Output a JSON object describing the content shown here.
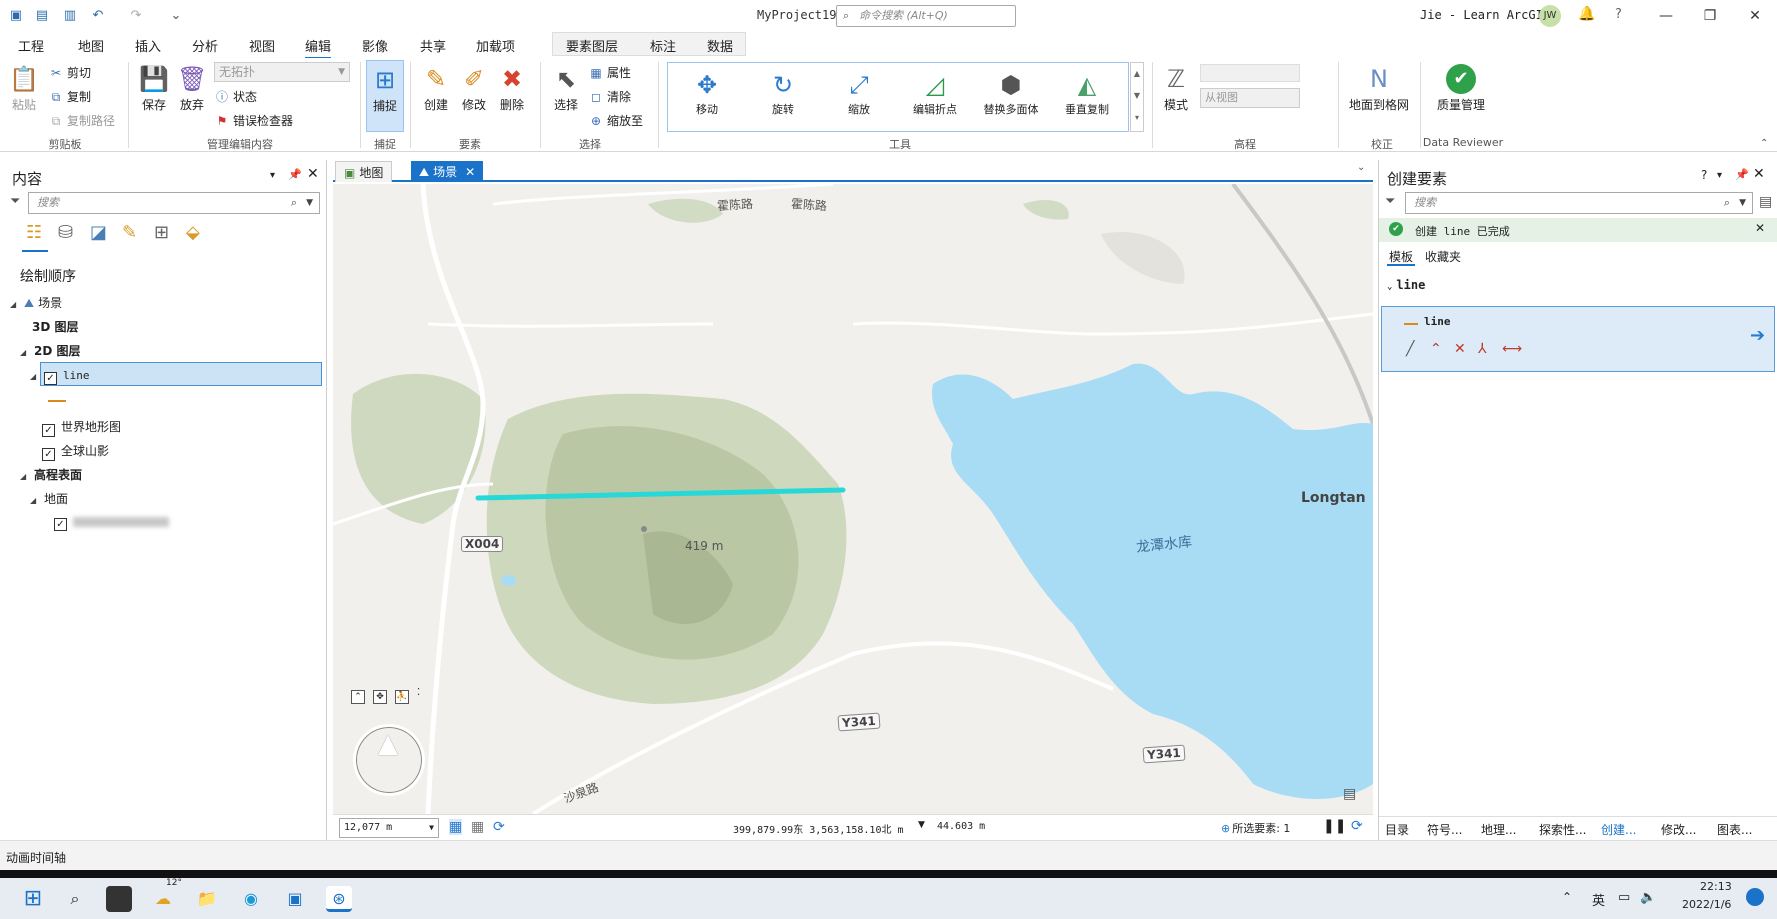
{
  "titlebar": {
    "app_title": "MyProject19",
    "search_placeholder": "命令搜索 (Alt+Q)",
    "user": "Jie - Learn ArcGIS",
    "avatar_initials": "JW"
  },
  "ribbon_tabs": [
    "工程",
    "地图",
    "插入",
    "分析",
    "视图",
    "编辑",
    "影像",
    "共享",
    "加载项"
  ],
  "active_tab": "编辑",
  "context_tabs": [
    "要素图层",
    "标注",
    "数据"
  ],
  "ribbon": {
    "clipboard": {
      "paste": "粘贴",
      "cut": "剪切",
      "copy": "复制",
      "copy_path": "复制路径",
      "label": "剪贴板"
    },
    "manage_edits": {
      "save": "保存",
      "discard": "放弃",
      "topology": "无拓扑",
      "status": "状态",
      "error_inspector": "错误检查器",
      "label": "管理编辑内容"
    },
    "snapping": {
      "snap": "捕捉",
      "label": "捕捉"
    },
    "features": {
      "create": "创建",
      "modify": "修改",
      "delete": "删除",
      "label": "要素"
    },
    "selection": {
      "select": "选择",
      "attributes": "属性",
      "clear": "清除",
      "zoom_to": "缩放至",
      "label": "选择"
    },
    "tools": {
      "items": [
        "移动",
        "旋转",
        "缩放",
        "编辑折点",
        "替换多面体",
        "垂直复制"
      ],
      "label": "工具"
    },
    "elevation": {
      "mode": "模式",
      "from_view": "从视图",
      "label": "高程"
    },
    "correction": {
      "ground_to_grid": "地面到格网",
      "label": "校正"
    },
    "data_reviewer": {
      "quality": "质量管理",
      "label": "Data Reviewer"
    }
  },
  "contents": {
    "title": "内容",
    "search_placeholder": "搜索",
    "drawing_order": "绘制顺序",
    "scene": "场景",
    "layers_3d": "3D 图层",
    "layers_2d": "2D 图层",
    "line_layer": "line",
    "topo": "世界地形图",
    "hillshade": "全球山影",
    "elevation_surfaces": "高程表面",
    "ground": "地面"
  },
  "map_tabs": [
    {
      "label": "地图",
      "active": false
    },
    {
      "label": "场景",
      "active": true
    }
  ],
  "map": {
    "labels": [
      "霍陈路",
      "霍陈路",
      "X004",
      "419 m",
      "Y341",
      "Y341",
      "龙潭水库",
      "Longtan",
      "沙泉路"
    ],
    "line_color": "#27d8d8",
    "water_color": "#a8dcf5"
  },
  "map_status": {
    "scale": "12,077 m",
    "coords": "399,879.99东  3,563,158.10北 m",
    "elevation": "44.603 m",
    "selected": "所选要素: 1"
  },
  "create_features": {
    "title": "创建要素",
    "search_placeholder": "搜索",
    "notice": "创建 line 已完成",
    "tab_templates": "模板",
    "tab_favorites": "收藏夹",
    "group": "line",
    "template": "line"
  },
  "bottom_tabs": [
    "目录",
    "符号...",
    "地理...",
    "探索性...",
    "创建...",
    "修改...",
    "图表..."
  ],
  "animation_label": "动画时间轴",
  "taskbar": {
    "weather": "12°",
    "lang": "英",
    "time": "22:13",
    "date": "2022/1/6"
  }
}
